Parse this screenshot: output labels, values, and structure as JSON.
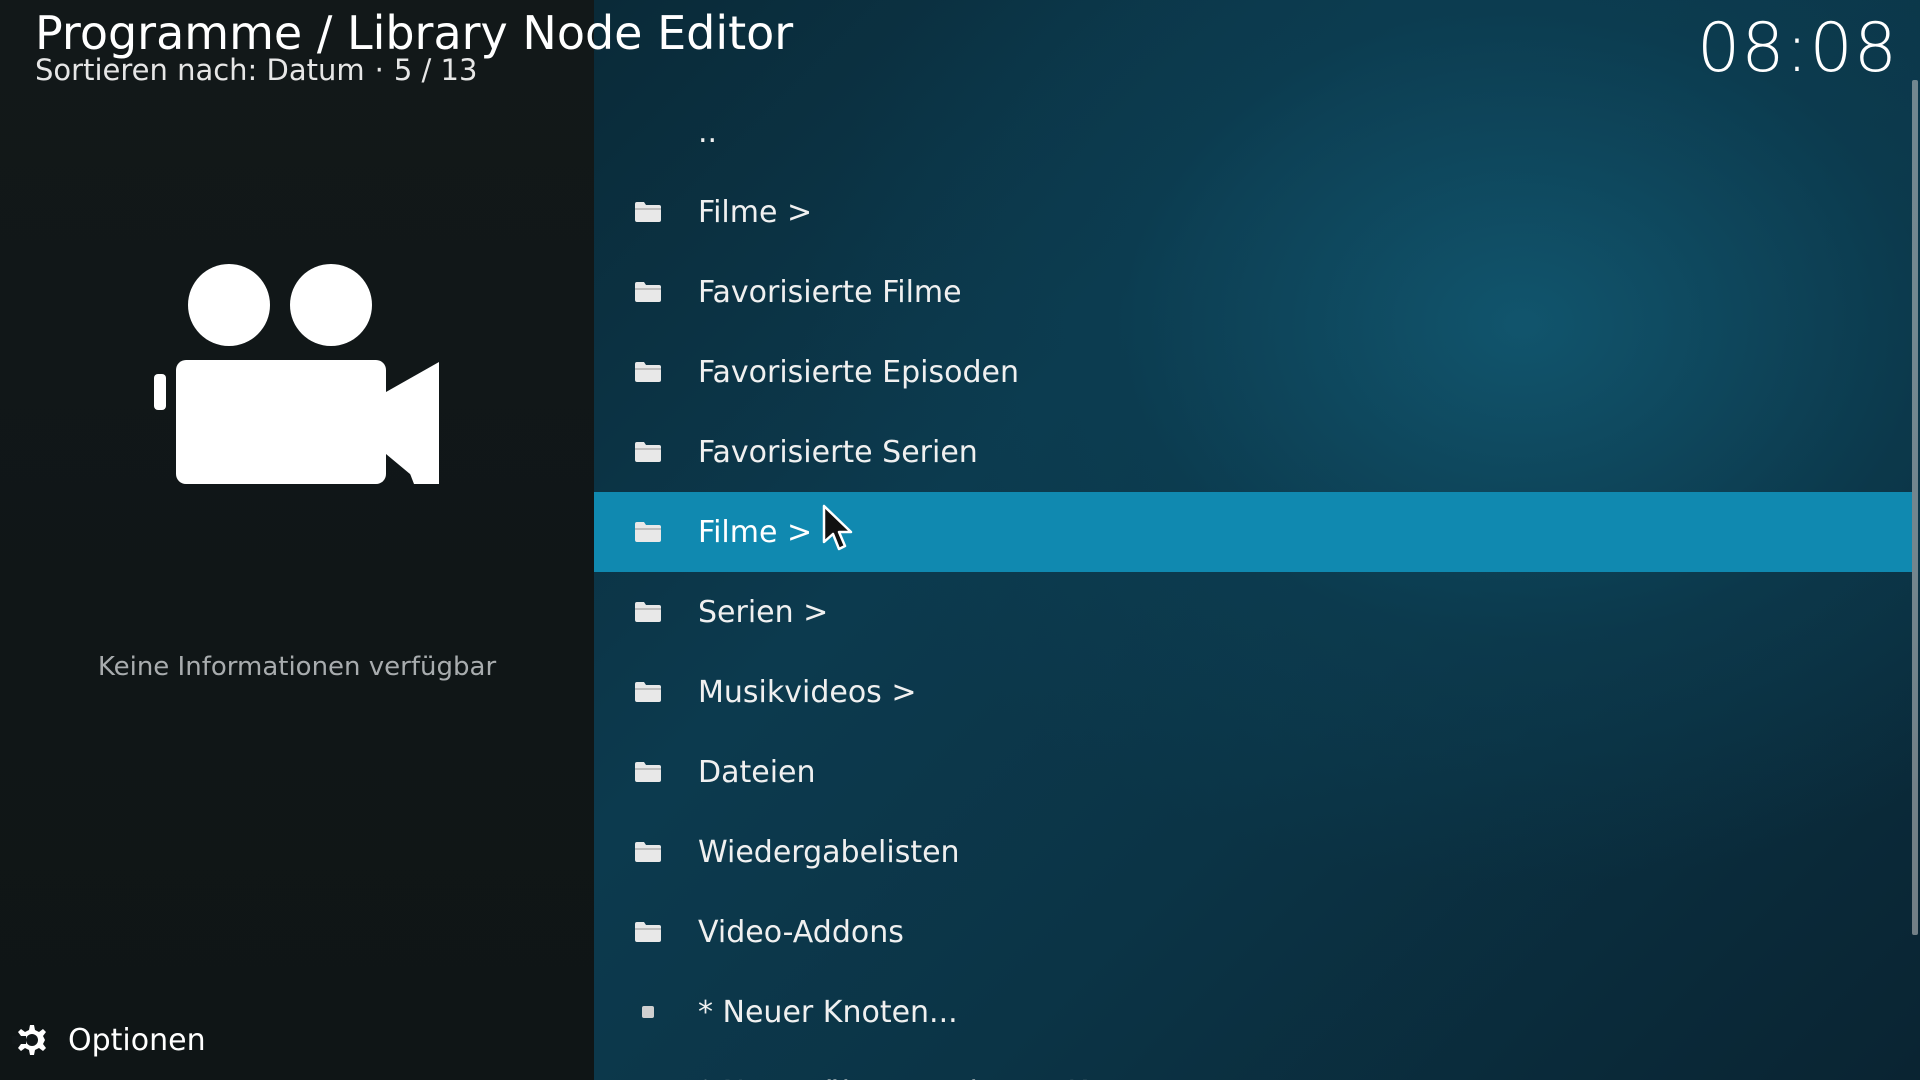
{
  "header": {
    "title": "Programme / Library Node Editor",
    "sort_label": "Sortieren nach: Datum",
    "separator": "·",
    "position": "5 / 13"
  },
  "clock": "08:08",
  "info_panel": {
    "icon": "video-camera-icon",
    "no_info_text": "Keine Informationen verfügbar"
  },
  "options": {
    "icon": "gear-icon",
    "label": "Optionen"
  },
  "list": {
    "selected_index": 5,
    "items": [
      {
        "label": "..",
        "icon": "none"
      },
      {
        "label": "Filme >",
        "icon": "folder-icon"
      },
      {
        "label": "Favorisierte Filme",
        "icon": "folder-icon"
      },
      {
        "label": "Favorisierte Episoden",
        "icon": "folder-icon"
      },
      {
        "label": "Favorisierte Serien",
        "icon": "folder-icon"
      },
      {
        "label": "Filme >",
        "icon": "folder-icon"
      },
      {
        "label": "Serien >",
        "icon": "folder-icon"
      },
      {
        "label": "Musikvideos >",
        "icon": "folder-icon"
      },
      {
        "label": "Dateien",
        "icon": "folder-icon"
      },
      {
        "label": "Wiedergabelisten",
        "icon": "folder-icon"
      },
      {
        "label": "Video-Addons",
        "icon": "folder-icon"
      },
      {
        "label": "* Neuer Knoten...",
        "icon": "file-icon"
      },
      {
        "label": "* Neuer übergeordneter Knoten",
        "icon": "file-icon"
      }
    ]
  },
  "colors": {
    "selection": "#1089b0",
    "left_panel": "#121819",
    "right_panel": "#0c3a4e"
  }
}
